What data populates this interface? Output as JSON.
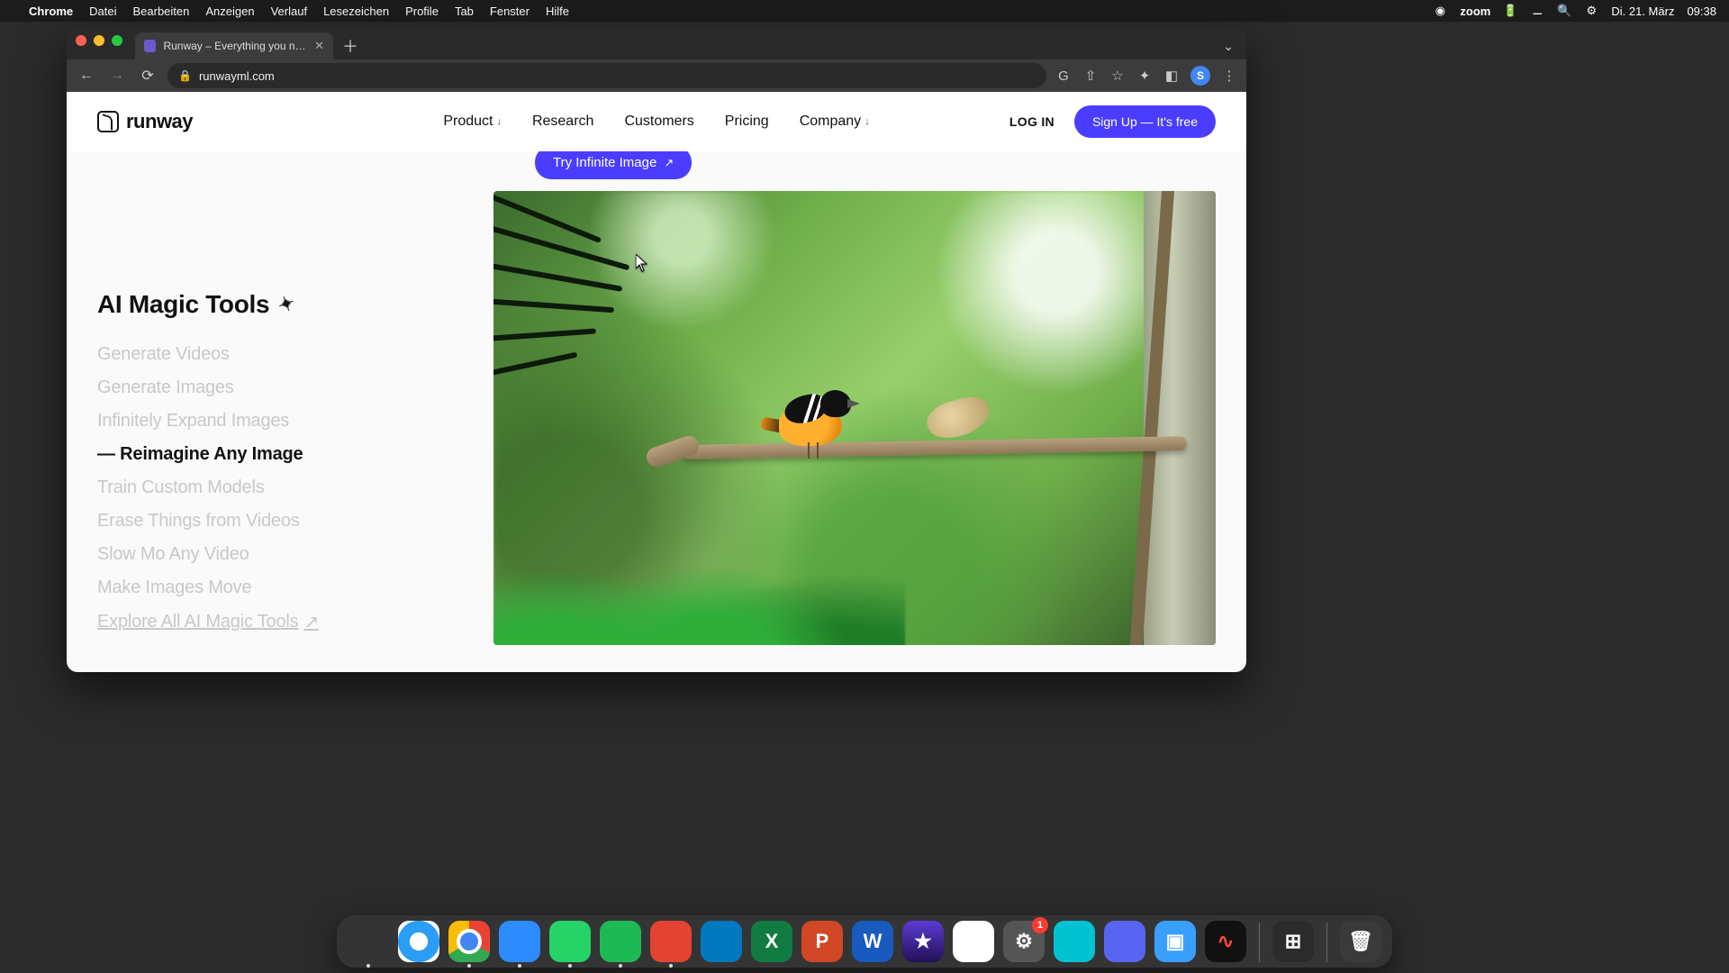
{
  "menubar": {
    "app": "Chrome",
    "items": [
      "Datei",
      "Bearbeiten",
      "Anzeigen",
      "Verlauf",
      "Lesezeichen",
      "Profile",
      "Tab",
      "Fenster",
      "Hilfe"
    ],
    "right": {
      "zoom": "zoom",
      "date": "Di. 21. März",
      "time": "09:38"
    }
  },
  "chrome": {
    "tab_title": "Runway – Everything you need",
    "url": "runwayml.com",
    "profile_initial": "S"
  },
  "header": {
    "brand": "runway",
    "nav": {
      "product": "Product",
      "research": "Research",
      "customers": "Customers",
      "pricing": "Pricing",
      "company": "Company"
    },
    "login": "LOG IN",
    "signup": "Sign Up — It's free"
  },
  "cta": {
    "label": "Try Infinite Image"
  },
  "section_title": "AI Magic Tools",
  "tools": [
    "Generate Videos",
    "Generate Images",
    "Infinitely Expand Images",
    "Reimagine Any Image",
    "Train Custom Models",
    "Erase Things from Videos",
    "Slow Mo Any Video",
    "Make Images Move"
  ],
  "tools_active_index": 3,
  "explore_label": "Explore All AI Magic Tools",
  "dock_badge_settings": "1"
}
